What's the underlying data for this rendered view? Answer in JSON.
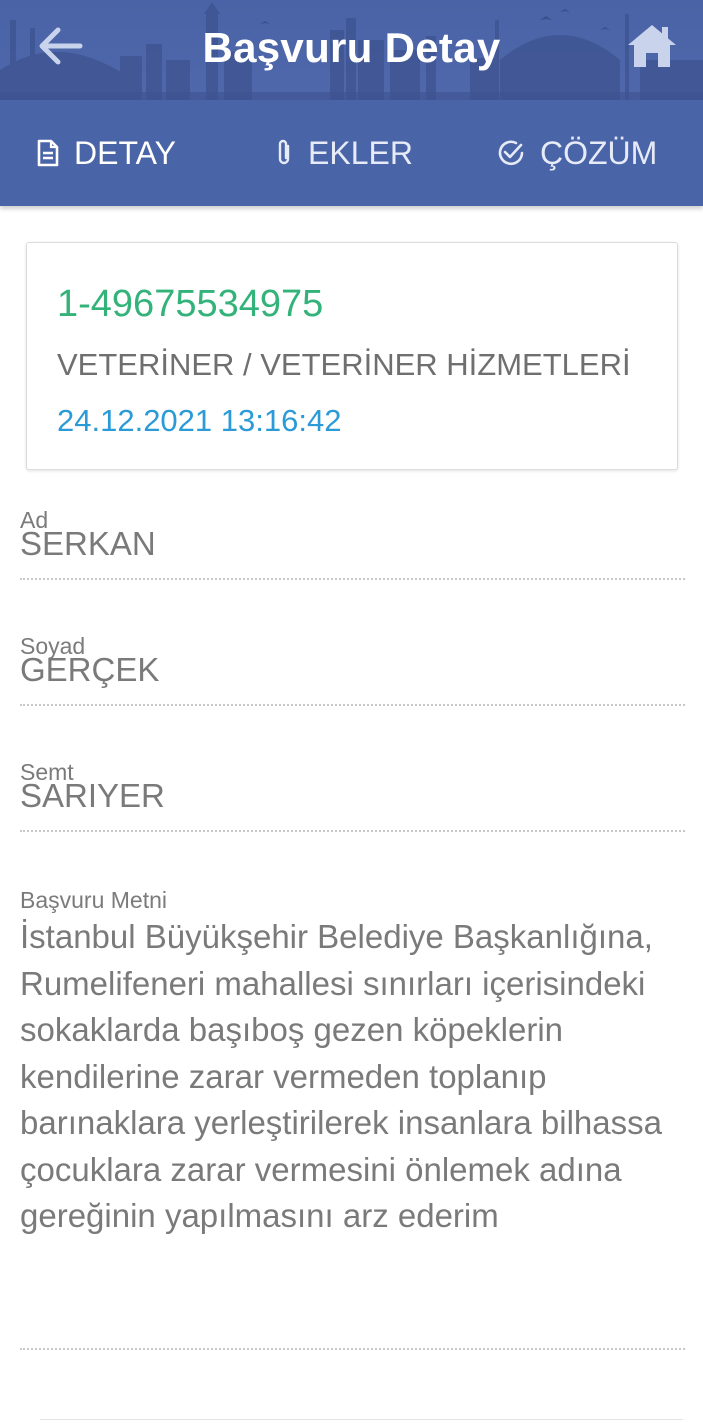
{
  "header": {
    "title": "Başvuru Detay",
    "back_icon": "arrow-left-icon",
    "home_icon": "home-icon",
    "background_color": "#4a63a6"
  },
  "tabs": [
    {
      "label": "DETAY",
      "icon": "document-icon"
    },
    {
      "label": "EKLER",
      "icon": "paperclip-icon"
    },
    {
      "label": "ÇÖZÜM",
      "icon": "check-circle-icon"
    }
  ],
  "card": {
    "id": "1-49675534975",
    "category": "VETERİNER / VETERİNER HİZMETLERİ",
    "date": "24.12.2021 13:16:42",
    "id_color": "#33b37a",
    "date_color": "#2a9bd6"
  },
  "fields": {
    "ad": {
      "label": "Ad",
      "value": "SERKAN"
    },
    "soyad": {
      "label": "Soyad",
      "value": "GERÇEK"
    },
    "semt": {
      "label": "Semt",
      "value": "SARIYER"
    },
    "metin": {
      "label": "Başvuru Metni",
      "value": "İstanbul Büyükşehir Belediye Başkanlığına, Rumelifeneri mahallesi sınırları içerisindeki sokaklarda başıboş gezen köpeklerin kendilerine zarar vermeden toplanıp barınaklara yerleştirilerek insanlara bilhassa çocuklara zarar vermesini önlemek adına gereğinin yapılmasını arz ederim"
    }
  }
}
